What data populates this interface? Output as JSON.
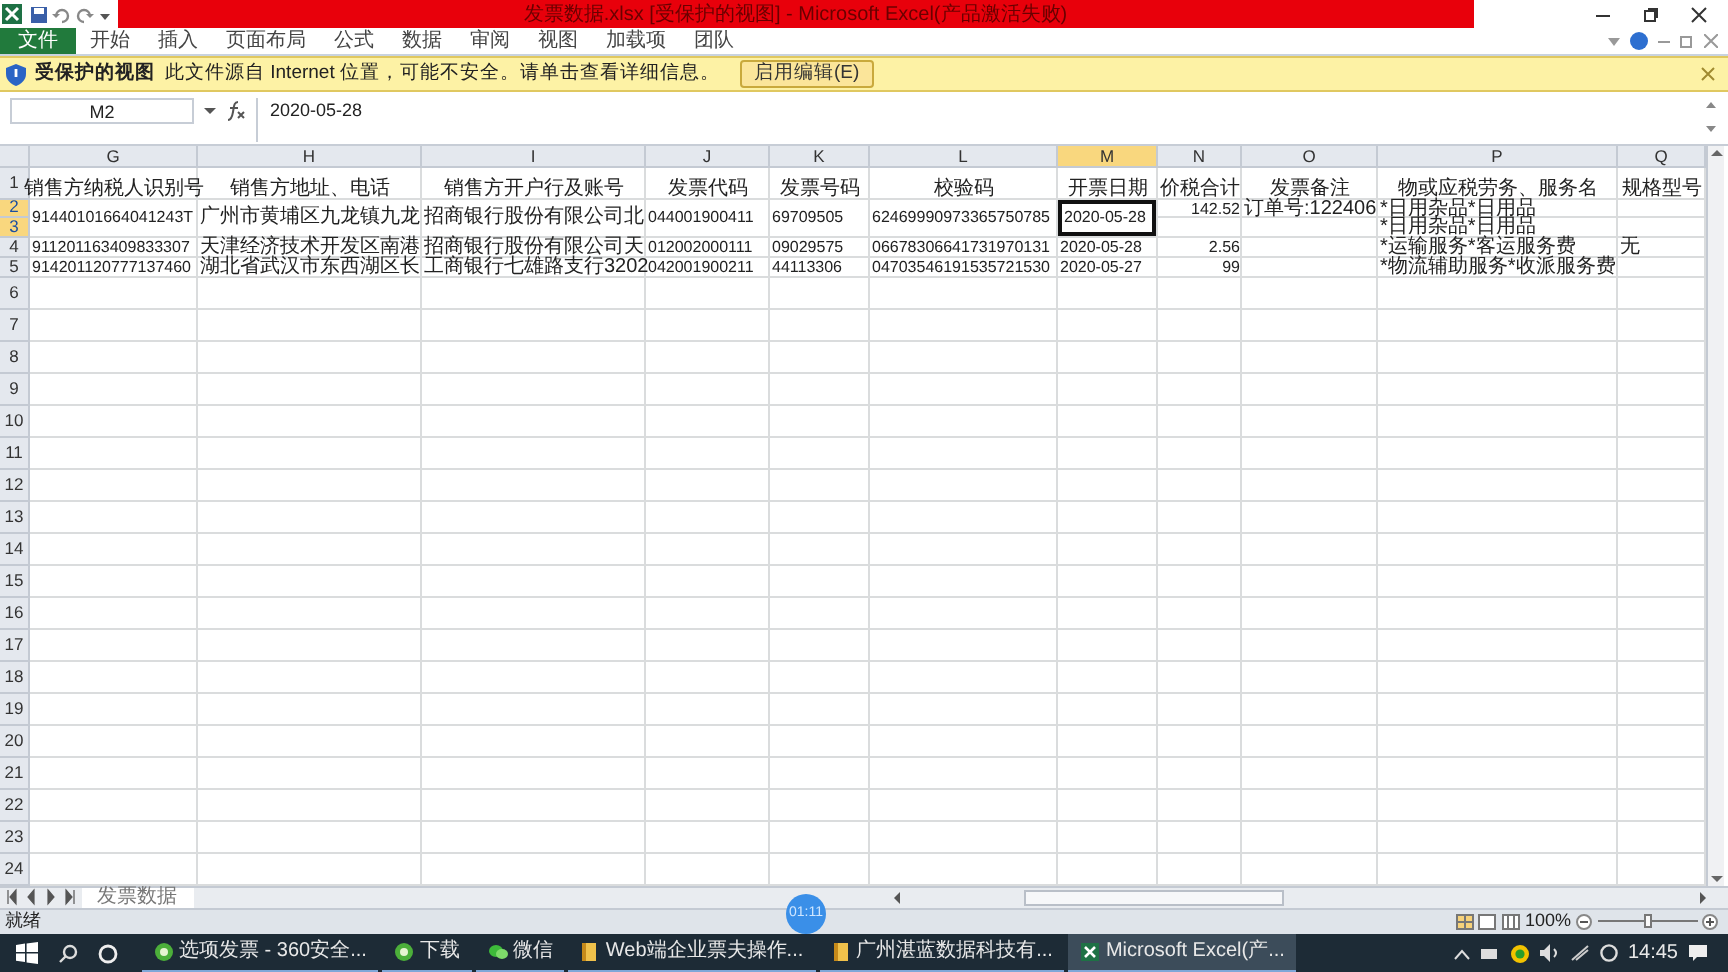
{
  "window": {
    "title": "发票数据.xlsx [受保护的视图] - Microsoft Excel(产品激活失败)"
  },
  "ribbon_tabs": [
    {
      "label": "文件",
      "selected": true
    },
    {
      "label": "开始",
      "selected": false
    },
    {
      "label": "插入",
      "selected": false
    },
    {
      "label": "页面布局",
      "selected": false
    },
    {
      "label": "公式",
      "selected": false
    },
    {
      "label": "数据",
      "selected": false
    },
    {
      "label": "审阅",
      "selected": false
    },
    {
      "label": "视图",
      "selected": false
    },
    {
      "label": "加载项",
      "selected": false
    },
    {
      "label": "团队",
      "selected": false
    }
  ],
  "protected_view": {
    "title": "受保护的视图",
    "message": "此文件源自 Internet 位置，可能不安全。请单击查看详细信息。",
    "button": "启用编辑(E)"
  },
  "formula_bar": {
    "name_box": "M2",
    "value": "2020-05-28"
  },
  "sheet": {
    "columns": [
      {
        "letter": "G",
        "selected": false
      },
      {
        "letter": "H",
        "selected": false
      },
      {
        "letter": "I",
        "selected": false
      },
      {
        "letter": "J",
        "selected": false
      },
      {
        "letter": "K",
        "selected": false
      },
      {
        "letter": "L",
        "selected": false
      },
      {
        "letter": "M",
        "selected": true
      },
      {
        "letter": "N",
        "selected": false
      },
      {
        "letter": "O",
        "selected": false
      },
      {
        "letter": "P",
        "selected": false
      },
      {
        "letter": "Q",
        "selected": false
      }
    ],
    "rows": [
      {
        "number": "1",
        "selected": false,
        "cells": [
          {
            "text": "销售方纳税人识别号",
            "kind": "header"
          },
          {
            "text": "销售方地址、电话",
            "kind": "header"
          },
          {
            "text": "销售方开户行及账号",
            "kind": "header"
          },
          {
            "text": "发票代码",
            "kind": "header"
          },
          {
            "text": "发票号码",
            "kind": "header"
          },
          {
            "text": "校验码",
            "kind": "header"
          },
          {
            "text": "开票日期",
            "kind": "header"
          },
          {
            "text": "价税合计",
            "kind": "header"
          },
          {
            "text": "发票备注",
            "kind": "header"
          },
          {
            "text": "物或应税劳务、服务名",
            "kind": "header"
          },
          {
            "text": "规格型号",
            "kind": "header"
          }
        ]
      },
      {
        "number": "2",
        "selected": true,
        "cells": [
          {
            "text": "91440101664041243T",
            "kind": "text",
            "merged": true
          },
          {
            "text": "广州市黄埔区九龙镇九龙",
            "kind": "text",
            "merged": true
          },
          {
            "text": "招商银行股份有限公司北",
            "kind": "text",
            "merged": true
          },
          {
            "text": "044001900411",
            "kind": "text",
            "merged": true
          },
          {
            "text": "69709505",
            "kind": "text",
            "merged": true
          },
          {
            "text": "62469990973365750785",
            "kind": "text",
            "merged": true
          },
          {
            "text": "2020-05-28",
            "kind": "text",
            "merged": true,
            "active": true
          },
          {
            "text": "142.52",
            "kind": "number"
          },
          {
            "text": "订单号:122406",
            "kind": "text"
          },
          {
            "text": "*日用杂品*日用品",
            "kind": "text"
          },
          null
        ]
      },
      {
        "number": "3",
        "selected": true,
        "cells": [
          null,
          null,
          null,
          null,
          null,
          null,
          null,
          null,
          null,
          {
            "text": "*日用杂品*日用品",
            "kind": "text"
          },
          null
        ]
      },
      {
        "number": "4",
        "selected": false,
        "cells": [
          {
            "text": "911201163409833307",
            "kind": "text"
          },
          {
            "text": "天津经济技术开发区南港",
            "kind": "text"
          },
          {
            "text": "招商银行股份有限公司天",
            "kind": "text"
          },
          {
            "text": "012002000111",
            "kind": "text"
          },
          {
            "text": "09029575",
            "kind": "text"
          },
          {
            "text": "06678306641731970131",
            "kind": "text"
          },
          {
            "text": "2020-05-28",
            "kind": "text"
          },
          {
            "text": "2.56",
            "kind": "number"
          },
          null,
          {
            "text": "*运输服务*客运服务费",
            "kind": "text"
          },
          {
            "text": "无",
            "kind": "text"
          }
        ]
      },
      {
        "number": "5",
        "selected": false,
        "cells": [
          {
            "text": "914201120777137460",
            "kind": "text"
          },
          {
            "text": "湖北省武汉市东西湖区长",
            "kind": "text"
          },
          {
            "text": "工商银行七雄路支行3202",
            "kind": "text"
          },
          {
            "text": "042001900211",
            "kind": "text"
          },
          {
            "text": "44113306",
            "kind": "text"
          },
          {
            "text": "04703546191535721530",
            "kind": "text"
          },
          {
            "text": "2020-05-27",
            "kind": "text"
          },
          {
            "text": "99",
            "kind": "number"
          },
          null,
          {
            "text": "*物流辅助服务*收派服务费",
            "kind": "text"
          },
          null
        ]
      },
      {
        "number": "6"
      },
      {
        "number": "7"
      },
      {
        "number": "8"
      },
      {
        "number": "9"
      },
      {
        "number": "10"
      },
      {
        "number": "11"
      },
      {
        "number": "12"
      },
      {
        "number": "13"
      },
      {
        "number": "14"
      },
      {
        "number": "15"
      },
      {
        "number": "16"
      },
      {
        "number": "17"
      },
      {
        "number": "18"
      },
      {
        "number": "19"
      },
      {
        "number": "20"
      },
      {
        "number": "21"
      },
      {
        "number": "22"
      },
      {
        "number": "23"
      },
      {
        "number": "24"
      }
    ]
  },
  "sheet_tabs": [
    {
      "label": "发票数据",
      "selected": true
    }
  ],
  "status_bar": {
    "status": "就绪",
    "zoom": "100%",
    "zoom_level": {
      "level": 0.5
    }
  },
  "video_overlay": {
    "time": "01:11"
  },
  "taskbar": {
    "items": [
      {
        "label": "选项发票 - 360安全...",
        "kind": "browser",
        "selected": false
      },
      {
        "label": "下载",
        "kind": "browser",
        "selected": false
      },
      {
        "label": "微信",
        "kind": "wechat",
        "selected": false
      },
      {
        "label": "Web端企业票夫操作...",
        "kind": "folder",
        "selected": false
      },
      {
        "label": "广州湛蓝数据科技有...",
        "kind": "folder",
        "selected": false
      },
      {
        "label": "Microsoft Excel(产...",
        "kind": "excel",
        "selected": true
      }
    ],
    "time": "14:45"
  }
}
